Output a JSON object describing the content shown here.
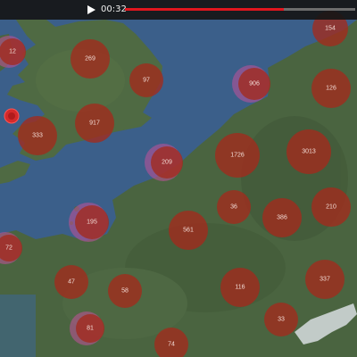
{
  "player": {
    "time": "00:32",
    "progress": 0.69,
    "play_icon": "play-icon",
    "progress_color": "#e0161e"
  },
  "map": {
    "water_color": "#3b5f8a",
    "land_color": "#4a6440",
    "marker_color": "#a32a1c",
    "marker_halo_color": "#c2519a"
  },
  "clusters": [
    {
      "id": "c-12",
      "label": "12",
      "halo": true
    },
    {
      "id": "c-269",
      "label": "269",
      "halo": false
    },
    {
      "id": "c-97",
      "label": "97",
      "halo": false
    },
    {
      "id": "c-154",
      "label": "154",
      "halo": false
    },
    {
      "id": "c-906",
      "label": "906",
      "halo": true
    },
    {
      "id": "c-126",
      "label": "126",
      "halo": false
    },
    {
      "id": "c-917",
      "label": "917",
      "halo": false
    },
    {
      "id": "c-333",
      "label": "333",
      "halo": false
    },
    {
      "id": "c-209",
      "label": "209",
      "halo": true
    },
    {
      "id": "c-1726",
      "label": "1726",
      "halo": false
    },
    {
      "id": "c-3013",
      "label": "3013",
      "halo": false
    },
    {
      "id": "c-36",
      "label": "36",
      "halo": false
    },
    {
      "id": "c-386",
      "label": "386",
      "halo": false
    },
    {
      "id": "c-210",
      "label": "210",
      "halo": false
    },
    {
      "id": "c-195",
      "label": "195",
      "halo": true
    },
    {
      "id": "c-561",
      "label": "561",
      "halo": false
    },
    {
      "id": "c-72",
      "label": "72",
      "halo": true
    },
    {
      "id": "c-47",
      "label": "47",
      "halo": false
    },
    {
      "id": "c-58",
      "label": "58",
      "halo": false
    },
    {
      "id": "c-116",
      "label": "116",
      "halo": false
    },
    {
      "id": "c-337",
      "label": "337",
      "halo": false
    },
    {
      "id": "c-81",
      "label": "81",
      "halo": true
    },
    {
      "id": "c-33",
      "label": "33",
      "halo": false
    },
    {
      "id": "c-74",
      "label": "74",
      "halo": false
    }
  ]
}
